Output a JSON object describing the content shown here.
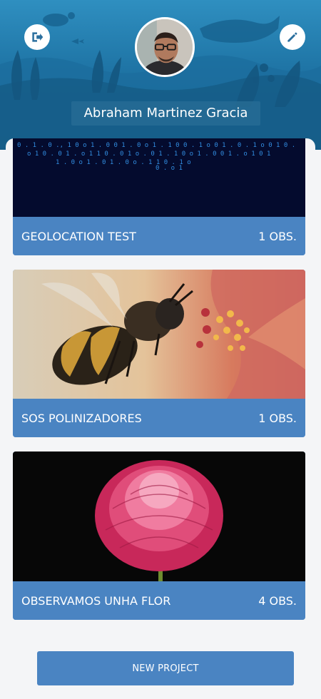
{
  "profile": {
    "user_name": "Abraham Martinez Gracia"
  },
  "icons": {
    "logout": "logout-icon",
    "edit": "pencil-icon"
  },
  "colors": {
    "accent": "#4a84c2",
    "header": "#1f75a6",
    "background": "#f4f5f7"
  },
  "projects": [
    {
      "title": "GEOLOCATION TEST",
      "count": "1 OBS."
    },
    {
      "title": "SOS POLINIZADORES",
      "count": "1 OBS."
    },
    {
      "title": "OBSERVAMOS UNHA FLOR",
      "count": "4 OBS."
    }
  ],
  "actions": {
    "new_project_label": "NEW PROJECT"
  }
}
